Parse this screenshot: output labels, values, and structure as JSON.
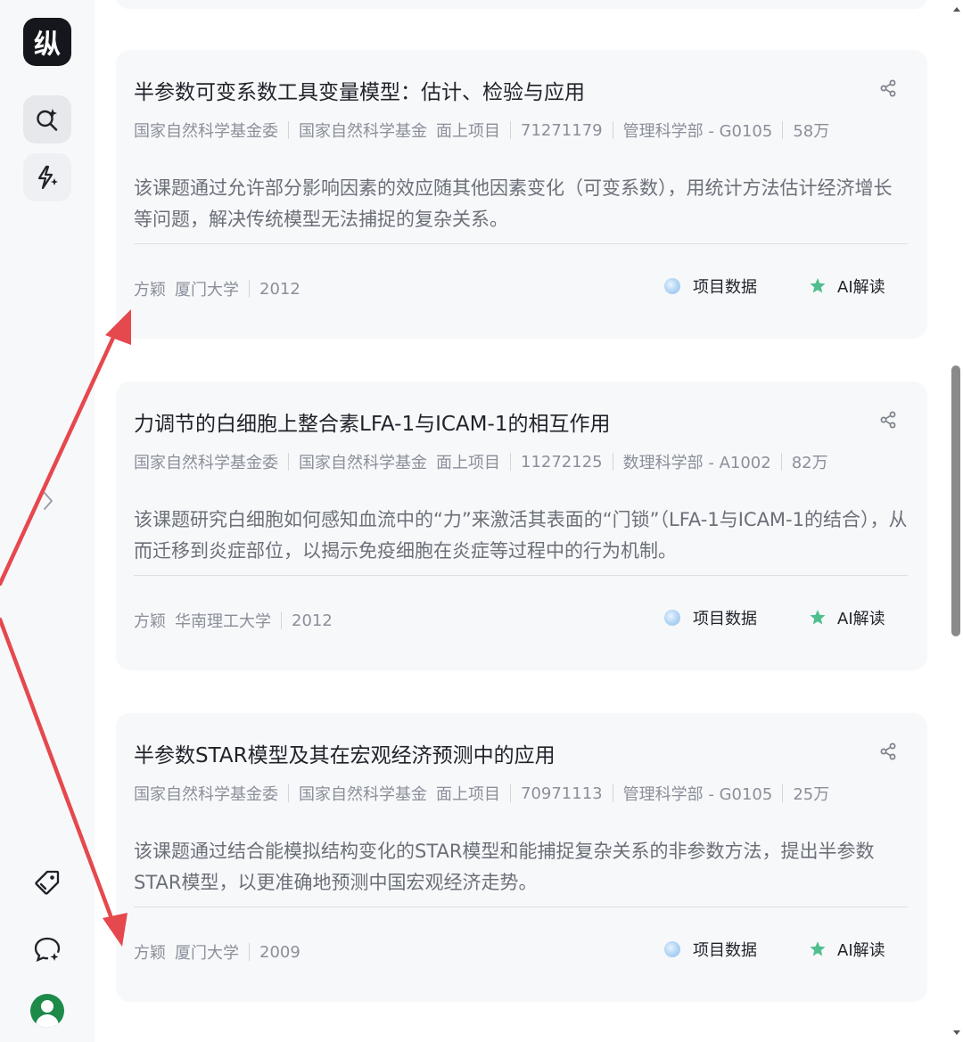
{
  "sidebar": {
    "logo_text": "纵",
    "items": [
      {
        "icon": "ai-search-icon"
      },
      {
        "icon": "ai-spark-icon"
      },
      {
        "icon": "tag-icon"
      },
      {
        "icon": "chat-icon"
      },
      {
        "icon": "avatar"
      }
    ]
  },
  "cards": [
    {
      "title": "半参数可变系数工具变量模型：估计、检验与应用",
      "funder": "国家自然科学基金委",
      "program": "国家自然科学基金",
      "type": "面上项目",
      "grant_no": "71271179",
      "dept": "管理科学部 - G0105",
      "amount": "58万",
      "description": "该课题通过允许部分影响因素的效应随其他因素变化（可变系数），用统计方法估计经济增长等问题，解决传统模型无法捕捉的复杂关系。",
      "pi": "方颖",
      "institution": "厦门大学",
      "year": "2012",
      "data_label": "项目数据",
      "ai_label": "AI解读"
    },
    {
      "title": "力调节的白细胞上整合素LFA-1与ICAM-1的相互作用",
      "funder": "国家自然科学基金委",
      "program": "国家自然科学基金",
      "type": "面上项目",
      "grant_no": "11272125",
      "dept": "数理科学部 - A1002",
      "amount": "82万",
      "description": "该课题研究白细胞如何感知血流中的“力”来激活其表面的“门锁”（LFA-1与ICAM-1的结合），从而迁移到炎症部位，以揭示免疫细胞在炎症等过程中的行为机制。",
      "pi": "方颖",
      "institution": "华南理工大学",
      "year": "2012",
      "data_label": "项目数据",
      "ai_label": "AI解读"
    },
    {
      "title": "半参数STAR模型及其在宏观经济预测中的应用",
      "funder": "国家自然科学基金委",
      "program": "国家自然科学基金",
      "type": "面上项目",
      "grant_no": "70971113",
      "dept": "管理科学部 - G0105",
      "amount": "25万",
      "description": "该课题通过结合能模拟结构变化的STAR模型和能捕捉复杂关系的非参数方法，提出半参数STAR模型，以更准确地预测中国宏观经济走势。",
      "pi": "方颖",
      "institution": "厦门大学",
      "year": "2009",
      "data_label": "项目数据",
      "ai_label": "AI解读"
    }
  ],
  "colors": {
    "card_bg": "#f7f8fa",
    "annotation_arrow": "#e5484d",
    "ai_icon": "#4fbf8f",
    "data_icon": "#8cc0ee"
  }
}
